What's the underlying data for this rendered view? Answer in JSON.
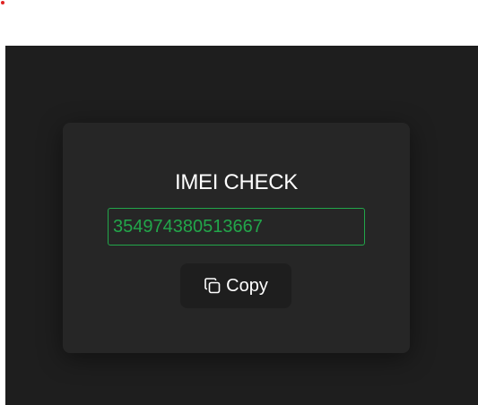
{
  "title": "IMEI CHECK",
  "imei": {
    "value": "354974380513667"
  },
  "copy_button": {
    "label": "Copy",
    "icon": "copy-icon"
  },
  "colors": {
    "accent_green": "#22a64a",
    "corner_dot": "#e02424"
  }
}
